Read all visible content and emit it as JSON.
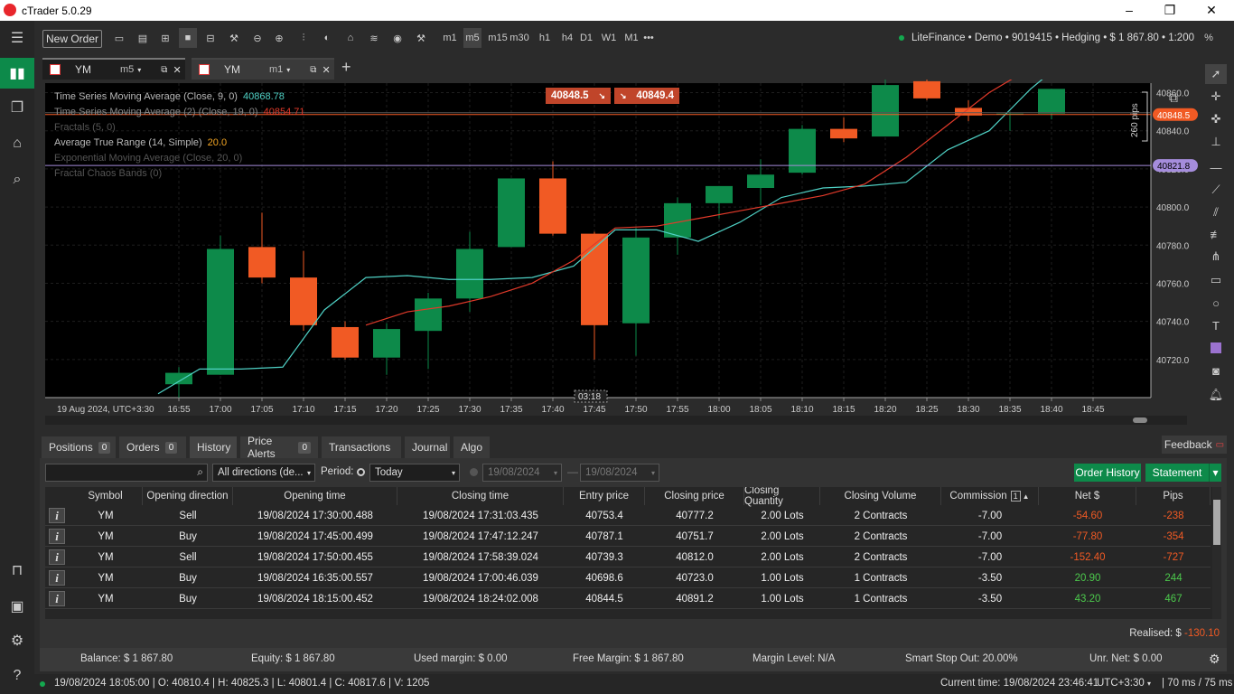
{
  "window": {
    "title": "cTrader 5.0.29"
  },
  "toolbar": {
    "new_order": "New Order",
    "timeframes": [
      "m1",
      "m5",
      "m15",
      "m30",
      "h1",
      "h4",
      "D1",
      "W1",
      "M1"
    ],
    "more": "•••",
    "account": "LiteFinance • Demo • 9019415 • Hedging • $ 1 867.80 • 1:200",
    "percent": "%"
  },
  "chart_tabs": [
    {
      "symbol": "YM",
      "tf": "m5"
    },
    {
      "symbol": "YM",
      "tf": "m1"
    }
  ],
  "chart_labels": {
    "indicators": [
      {
        "name": "Time Series Moving Average (Close, 9, 0)",
        "value": "40868.78",
        "name_color": "#b8b8b8",
        "value_color": "#4fd1c5"
      },
      {
        "name": "Time Series Moving Average (2) (Close, 19, 0)",
        "value": "40854.71",
        "name_color": "#8a8a8a",
        "value_color": "#e23a2a"
      },
      {
        "name": "Fractals (5, 0)",
        "value": "",
        "name_color": "#555555",
        "value_color": "#555555"
      },
      {
        "name": "Average True Range (14, Simple)",
        "value": "20.0",
        "name_color": "#b8b8b8",
        "value_color": "#f5a623"
      },
      {
        "name": "Exponential Moving Average (Close, 20, 0)",
        "value": "",
        "name_color": "#555555",
        "value_color": "#555555"
      },
      {
        "name": "Fractal Chaos Bands (0)",
        "value": "",
        "name_color": "#555555",
        "value_color": "#555555"
      }
    ],
    "sell_price": "40848.5",
    "buy_price": "40849.4",
    "pips_label": "260 pips",
    "last_price_tag": "40848.5",
    "line_price_tag": "40821.8",
    "crosshair_time": "03:18",
    "date_label": "19 Aug 2024, UTC+3:30"
  },
  "chart_data": {
    "type": "candlestick",
    "symbol": "YM",
    "timeframe": "m5",
    "ylim": [
      40700,
      40865
    ],
    "y_ticks": [
      40720.0,
      40740.0,
      40760.0,
      40780.0,
      40800.0,
      40820.0,
      40840.0,
      40860.0
    ],
    "x_ticks": [
      "16:55",
      "17:00",
      "17:05",
      "17:10",
      "17:15",
      "17:20",
      "17:25",
      "17:30",
      "17:35",
      "17:40",
      "17:45",
      "17:50",
      "17:55",
      "18:00",
      "18:05",
      "18:10",
      "18:15",
      "18:20",
      "18:25",
      "18:30",
      "18:35",
      "18:40",
      "18:45"
    ],
    "candles": [
      {
        "t": "16:55",
        "o": 40707,
        "h": 40716,
        "l": 40700,
        "c": 40713
      },
      {
        "t": "17:00",
        "o": 40712,
        "h": 40785,
        "l": 40712,
        "c": 40778
      },
      {
        "t": "17:05",
        "o": 40779,
        "h": 40797,
        "l": 40760,
        "c": 40763
      },
      {
        "t": "17:10",
        "o": 40763,
        "h": 40777,
        "l": 40735,
        "c": 40738
      },
      {
        "t": "17:15",
        "o": 40737,
        "h": 40740,
        "l": 40720,
        "c": 40721
      },
      {
        "t": "17:20",
        "o": 40721,
        "h": 40739,
        "l": 40712,
        "c": 40736
      },
      {
        "t": "17:25",
        "o": 40735,
        "h": 40755,
        "l": 40715,
        "c": 40752
      },
      {
        "t": "17:30",
        "o": 40752,
        "h": 40787,
        "l": 40745,
        "c": 40778
      },
      {
        "t": "17:35",
        "o": 40779,
        "h": 40812,
        "l": 40779,
        "c": 40815
      },
      {
        "t": "17:40",
        "o": 40815,
        "h": 40824,
        "l": 40785,
        "c": 40786
      },
      {
        "t": "17:45",
        "o": 40786,
        "h": 40787,
        "l": 40720,
        "c": 40738
      },
      {
        "t": "17:50",
        "o": 40739,
        "h": 40789,
        "l": 40722,
        "c": 40784
      },
      {
        "t": "17:55",
        "o": 40784,
        "h": 40805,
        "l": 40775,
        "c": 40802
      },
      {
        "t": "18:00",
        "o": 40802,
        "h": 40811,
        "l": 40794,
        "c": 40811
      },
      {
        "t": "18:05",
        "o": 40810,
        "h": 40825,
        "l": 40801,
        "c": 40817
      },
      {
        "t": "18:10",
        "o": 40818,
        "h": 40843,
        "l": 40817,
        "c": 40841
      },
      {
        "t": "18:15",
        "o": 40841,
        "h": 40847,
        "l": 40834,
        "c": 40836
      },
      {
        "t": "18:20",
        "o": 40837,
        "h": 40868,
        "l": 40837,
        "c": 40864
      },
      {
        "t": "18:25",
        "o": 40866,
        "h": 40869,
        "l": 40856,
        "c": 40857
      },
      {
        "t": "18:30",
        "o": 40852,
        "h": 40856,
        "l": 40845,
        "c": 40848
      },
      {
        "t": "18:35",
        "o": 40849,
        "h": 40850,
        "l": 40840,
        "c": 40849
      },
      {
        "t": "18:40",
        "o": 40849,
        "h": 40862,
        "l": 40846,
        "c": 40862
      }
    ],
    "series": [
      {
        "name": "Time Series Moving Average (Close, 9, 0)",
        "color": "#4fd1c5",
        "values": [
          40702,
          40715,
          40715,
          40716,
          40746,
          40763,
          40764,
          40762,
          40762,
          40763,
          40769,
          40788,
          40788,
          40782,
          40792,
          40805,
          40810,
          40811,
          40813,
          40830,
          40840,
          40862,
          40880
        ]
      },
      {
        "name": "Time Series Moving Average (2) (Close, 19, 0)",
        "color": "#e23a2a",
        "values": [
          null,
          null,
          null,
          null,
          null,
          40738,
          40745,
          40748,
          40753,
          40760,
          40772,
          40789,
          40790,
          40794,
          40798,
          40802,
          40806,
          40812,
          40826,
          40843,
          40860,
          40873,
          40885
        ]
      }
    ]
  },
  "panel": {
    "tabs": [
      {
        "label": "Positions",
        "count": "0"
      },
      {
        "label": "Orders",
        "count": "0"
      },
      {
        "label": "History",
        "count": ""
      },
      {
        "label": "Price Alerts",
        "count": "0"
      },
      {
        "label": "Transactions",
        "count": ""
      },
      {
        "label": "Journal",
        "count": ""
      },
      {
        "label": "Algo",
        "count": ""
      }
    ],
    "feedback": "Feedback",
    "search_placeholder": "",
    "direction": "All directions (de...",
    "period_label": "Period:",
    "period": "Today",
    "date_from": "19/08/2024",
    "date_to": "19/08/2024",
    "order_history": "Order History",
    "statement": "Statement",
    "columns": [
      "Symbol",
      "Opening direction",
      "Opening time",
      "Closing time",
      "Entry price",
      "Closing price",
      "Closing Quantity",
      "Closing Volume",
      "Commission",
      "Net $",
      "Pips"
    ],
    "commission_sort_badge": "1",
    "rows": [
      [
        "YM",
        "Sell",
        "19/08/2024 17:30:00.488",
        "19/08/2024 17:31:03.435",
        "40753.4",
        "40777.2",
        "2.00 Lots",
        "2 Contracts",
        "-7.00",
        "-54.60",
        "-238"
      ],
      [
        "YM",
        "Buy",
        "19/08/2024 17:45:00.499",
        "19/08/2024 17:47:12.247",
        "40787.1",
        "40751.7",
        "2.00 Lots",
        "2 Contracts",
        "-7.00",
        "-77.80",
        "-354"
      ],
      [
        "YM",
        "Sell",
        "19/08/2024 17:50:00.455",
        "19/08/2024 17:58:39.024",
        "40739.3",
        "40812.0",
        "2.00 Lots",
        "2 Contracts",
        "-7.00",
        "-152.40",
        "-727"
      ],
      [
        "YM",
        "Buy",
        "19/08/2024 16:35:00.557",
        "19/08/2024 17:00:46.039",
        "40698.6",
        "40723.0",
        "1.00 Lots",
        "1 Contracts",
        "-3.50",
        "20.90",
        "244"
      ],
      [
        "YM",
        "Buy",
        "19/08/2024 18:15:00.452",
        "19/08/2024 18:24:02.008",
        "40844.5",
        "40891.2",
        "1.00 Lots",
        "1 Contracts",
        "-3.50",
        "43.20",
        "467"
      ]
    ],
    "realised_label": "Realised:  $",
    "realised_value": "-130.10",
    "footer": {
      "balance": "Balance: $ 1 867.80",
      "equity": "Equity: $ 1 867.80",
      "used_margin": "Used margin: $ 0.00",
      "free_margin": "Free Margin: $ 1 867.80",
      "margin_level": "Margin Level: N/A",
      "smart_stop": "Smart Stop Out: 20.00%",
      "unr_net": "Unr. Net:  $ 0.00"
    }
  },
  "status": {
    "ohlc": "19/08/2024 18:05:00  |  O: 40810.4  |  H: 40825.3  |  L: 40801.4  |  C: 40817.6  |  V: 1205",
    "current_time": "Current time:  19/08/2024 23:46:41",
    "tz": "UTC+3:30",
    "latency": "70 ms / 75 ms"
  }
}
